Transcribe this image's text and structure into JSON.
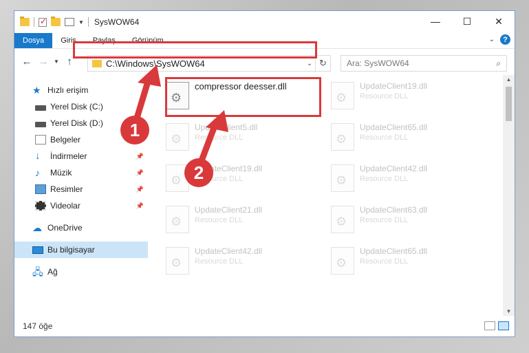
{
  "window": {
    "title": "SysWOW64",
    "controls": {
      "minimize": "—",
      "maximize": "☐",
      "close": "✕"
    }
  },
  "ribbon": {
    "tabs": [
      "Dosya",
      "Giriş",
      "Paylaş",
      "Görünüm"
    ],
    "help": "?"
  },
  "address": {
    "path": "C:\\Windows\\SysWOW64",
    "search_placeholder": "Ara: SysWOW64"
  },
  "nav": {
    "items": [
      {
        "label": "Hızlı erişim",
        "icon": "star-icon"
      },
      {
        "label": "Yerel Disk (C:)",
        "icon": "disk-icon"
      },
      {
        "label": "Yerel Disk (D:)",
        "icon": "disk-icon"
      },
      {
        "label": "Belgeler",
        "icon": "documents-icon"
      },
      {
        "label": "İndirmeler",
        "icon": "download-icon"
      },
      {
        "label": "Müzik",
        "icon": "music-icon"
      },
      {
        "label": "Resimler",
        "icon": "pictures-icon"
      },
      {
        "label": "Videolar",
        "icon": "videos-icon"
      },
      {
        "label": "OneDrive",
        "icon": "cloud-icon"
      },
      {
        "label": "Bu bilgisayar",
        "icon": "computer-icon"
      },
      {
        "label": "Ağ",
        "icon": "network-icon"
      }
    ]
  },
  "files": {
    "highlighted": {
      "name": "compressor deesser.dll"
    },
    "left_column": [
      {
        "name": "UpdateClient5.dll",
        "type": "Resource DLL"
      },
      {
        "name": "UpdateClient19.dll",
        "type": "Resource DLL"
      },
      {
        "name": "UpdateClient21.dll",
        "type": "Resource DLL"
      },
      {
        "name": "UpdateClient42.dll",
        "type": "Resource DLL"
      }
    ],
    "right_column": [
      {
        "name": "UpdateClient19.dll",
        "type": "Resource DLL"
      },
      {
        "name": "UpdateClient65.dll",
        "type": "Resource DLL"
      },
      {
        "name": "UpdateClient42.dll",
        "type": "Resource DLL"
      },
      {
        "name": "UpdateClient63.dll",
        "type": "Resource DLL"
      },
      {
        "name": "UpdateClient65.dll",
        "type": "Resource DLL"
      }
    ]
  },
  "status": {
    "count": "147 öğe"
  },
  "annotations": {
    "step1": "1",
    "step2": "2",
    "color": "#d9393b"
  }
}
